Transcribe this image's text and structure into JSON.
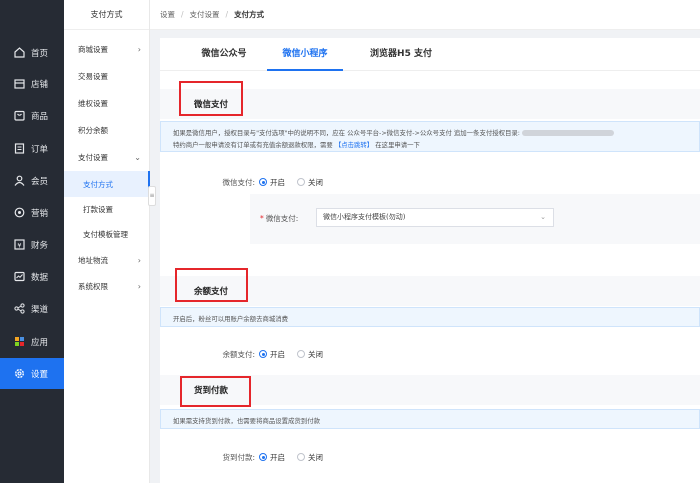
{
  "nav": {
    "items": [
      {
        "label": "首页",
        "icon": "home-icon"
      },
      {
        "label": "店铺",
        "icon": "store-icon"
      },
      {
        "label": "商品",
        "icon": "goods-icon"
      },
      {
        "label": "订单",
        "icon": "order-icon"
      },
      {
        "label": "会员",
        "icon": "member-icon"
      },
      {
        "label": "营销",
        "icon": "marketing-icon"
      },
      {
        "label": "财务",
        "icon": "finance-icon"
      },
      {
        "label": "数据",
        "icon": "data-icon"
      },
      {
        "label": "渠道",
        "icon": "channel-icon"
      },
      {
        "label": "应用",
        "icon": "apps-icon"
      },
      {
        "label": "设置",
        "icon": "settings-icon"
      }
    ],
    "active_color": "#1e72f0"
  },
  "submenu": {
    "title": "支付方式",
    "items": [
      {
        "label": "商城设置",
        "arrow": "›"
      },
      {
        "label": "交易设置"
      },
      {
        "label": "维权设置"
      },
      {
        "label": "积分余额"
      },
      {
        "label": "支付设置",
        "arrow": "⌄"
      },
      {
        "label": "支付方式"
      },
      {
        "label": "打款设置"
      },
      {
        "label": "支付模板管理"
      },
      {
        "label": "地址物流",
        "arrow": "›"
      },
      {
        "label": "系统权限",
        "arrow": "›"
      }
    ]
  },
  "breadcrumb": {
    "items": [
      "设置",
      "支付设置",
      "支付方式"
    ],
    "separator": "/"
  },
  "tabs": [
    "微信公众号",
    "微信小程序",
    "浏览器H5 支付"
  ],
  "wechat": {
    "title": "微信支付",
    "notice_line1": "如果是微信用户，授权目录与\"支付选项\"中的说明不同，应在 公众号平台->微信支付->公众号支付 追加一条支付授权目录:",
    "notice_line2_a": "特约商户一般申请没有订单或有充值余额退款权限，需要",
    "notice_link": "【点击跳转】",
    "notice_line2_b": "在这里申请一下",
    "label": "微信支付:",
    "on": "开启",
    "off": "关闭",
    "template_label": "微信支付:",
    "template_value": "微信小程序支付模板(勿动)"
  },
  "balance": {
    "title": "余额支付",
    "notice": "开启后，粉丝可以用账户余额去商城消费",
    "label": "余额支付:",
    "on": "开启",
    "off": "关闭"
  },
  "cod": {
    "title": "货到付款",
    "notice": "如果需支持货到付款，也需要将商品设置成货到付款",
    "label": "货到付款:",
    "on": "开启",
    "off": "关闭"
  },
  "colors": {
    "brand": "#1e72f0",
    "highlight_box": "#e5262b",
    "nav_bg": "#262b34"
  }
}
